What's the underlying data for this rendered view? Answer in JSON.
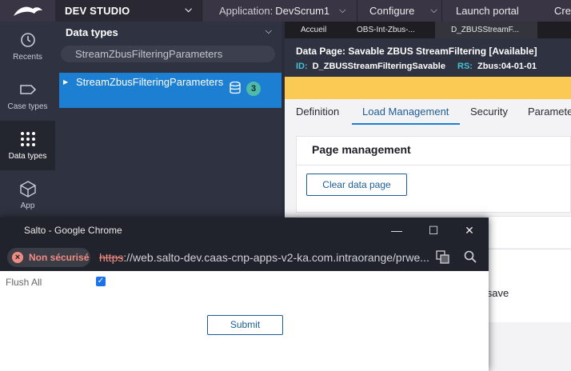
{
  "header": {
    "logo_icon": "pega-bird-logo-icon",
    "studio_label": "DEV STUDIO",
    "application_label": "Application:",
    "application_value": "DevScrum1",
    "configure_label": "Configure",
    "launch_portal_label": "Launch portal",
    "create_label": "Crea"
  },
  "left_nav": {
    "items": [
      {
        "label": "Recents",
        "icon": "history-icon"
      },
      {
        "label": "Case types",
        "icon": "case-types-icon"
      },
      {
        "label": "Data types",
        "icon": "grid-dots-icon"
      },
      {
        "label": "App",
        "icon": "cube-icon"
      }
    ]
  },
  "explorer": {
    "title": "Data types",
    "search_value": "StreamZbusFilteringParameters",
    "item_label": "StreamZbusFilteringParameters",
    "item_count": "3"
  },
  "main": {
    "tabs": [
      "Accueil",
      "OBS-Int-Zbus-...",
      "D_ZBUSStreamF..."
    ],
    "page_title": "Data Page: Savable ZBUS StreamFiltering [Available]",
    "id_key": "ID:",
    "id_value": "D_ZBUSStreamFilteringSavable",
    "rs_key": "RS:",
    "rs_value": "Zbus:04-01-01",
    "subtabs": [
      "Definition",
      "Load Management",
      "Security",
      "Paramete"
    ],
    "active_subtab": "Load Management",
    "section_title": "Page management",
    "clear_button": "Clear data page",
    "partial_text": "ul save"
  },
  "popup": {
    "window_title": "Salto - Google Chrome",
    "security_chip": "Non sécurisé",
    "url_scheme": "https",
    "url_rest": "://web.salto-dev.caas-cnp-apps-v2-ka.com.intraorange/prwe...",
    "flush_label": "Flush All",
    "flush_checked": true,
    "submit_label": "Submit"
  },
  "colors": {
    "accent_blue": "#1c7fd1",
    "warning_yellow": "#fbca55",
    "teal_badge": "#4fb9aa",
    "insecure_red": "#f28b82"
  }
}
